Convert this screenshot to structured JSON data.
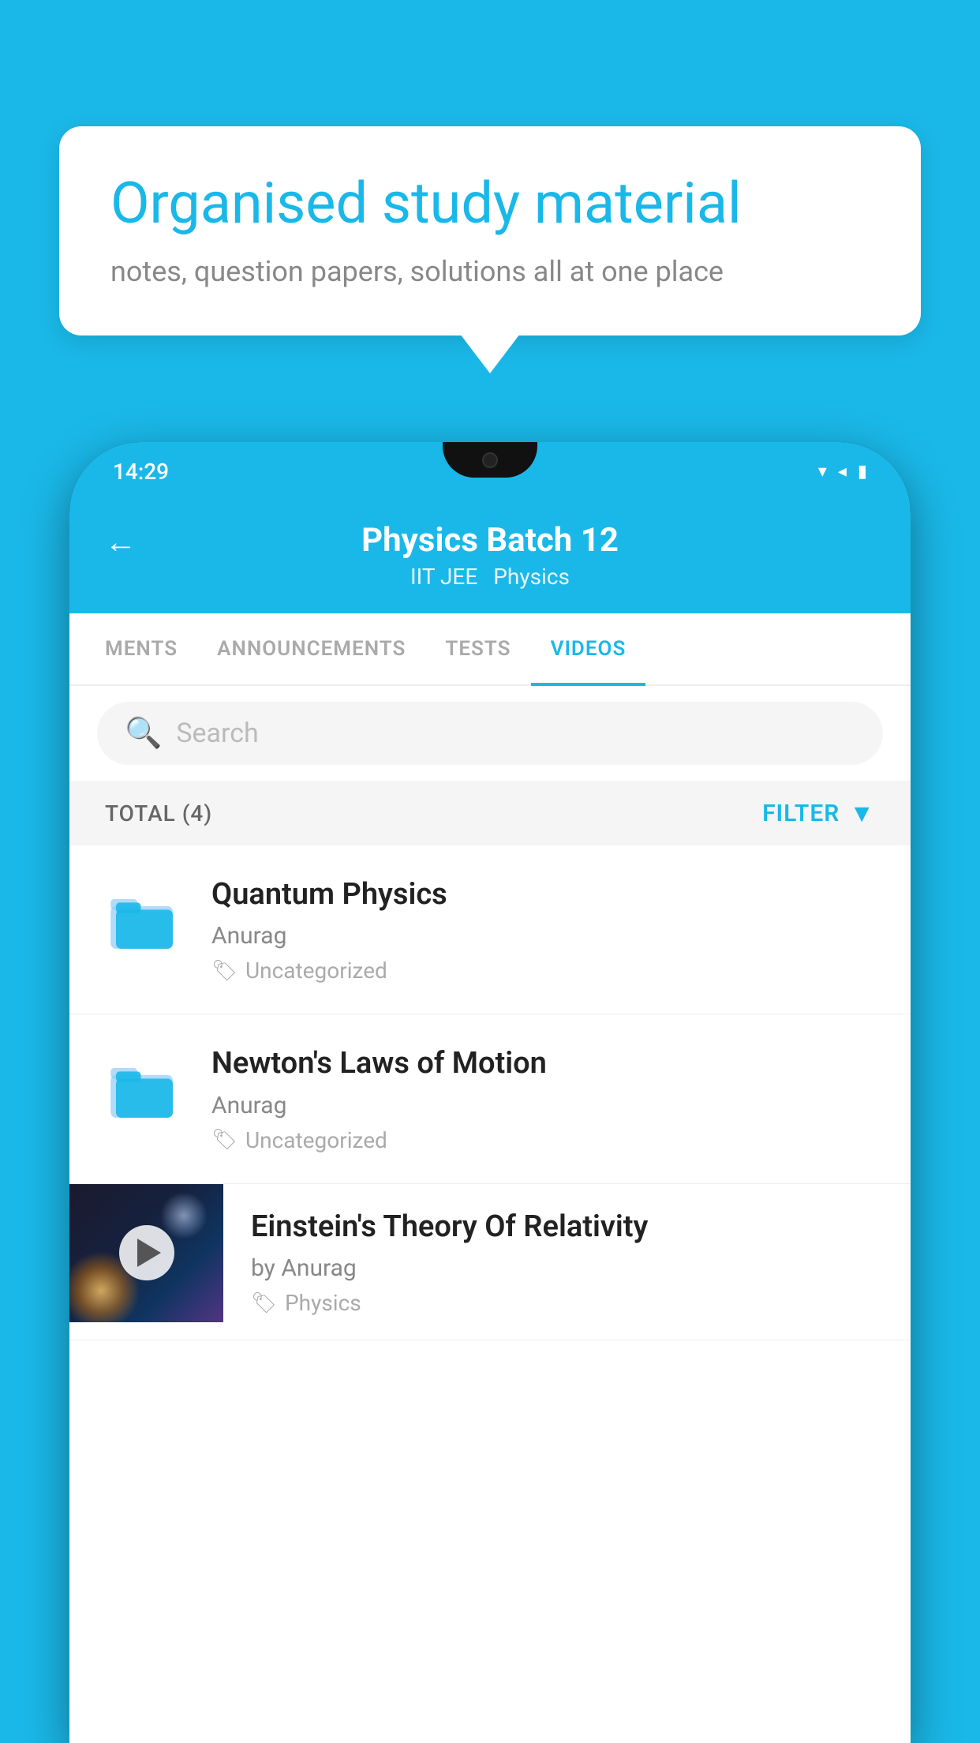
{
  "bubble": {
    "title": "Organised study material",
    "subtitle": "notes, question papers, solutions all at one place"
  },
  "statusBar": {
    "time": "14:29",
    "icons": [
      "wifi",
      "signal",
      "battery"
    ]
  },
  "header": {
    "title": "Physics Batch 12",
    "breadcrumb1": "IIT JEE",
    "breadcrumb2": "Physics",
    "back_label": "←"
  },
  "tabs": [
    {
      "label": "MENTS",
      "active": false
    },
    {
      "label": "ANNOUNCEMENTS",
      "active": false
    },
    {
      "label": "TESTS",
      "active": false
    },
    {
      "label": "VIDEOS",
      "active": true
    }
  ],
  "search": {
    "placeholder": "Search"
  },
  "filter": {
    "total_label": "TOTAL (4)",
    "filter_label": "FILTER"
  },
  "videos": [
    {
      "title": "Quantum Physics",
      "author": "Anurag",
      "tag": "Uncategorized",
      "type": "folder"
    },
    {
      "title": "Newton's Laws of Motion",
      "author": "Anurag",
      "tag": "Uncategorized",
      "type": "folder"
    },
    {
      "title": "Einstein's Theory Of Relativity",
      "author": "by Anurag",
      "tag": "Physics",
      "type": "video"
    }
  ]
}
